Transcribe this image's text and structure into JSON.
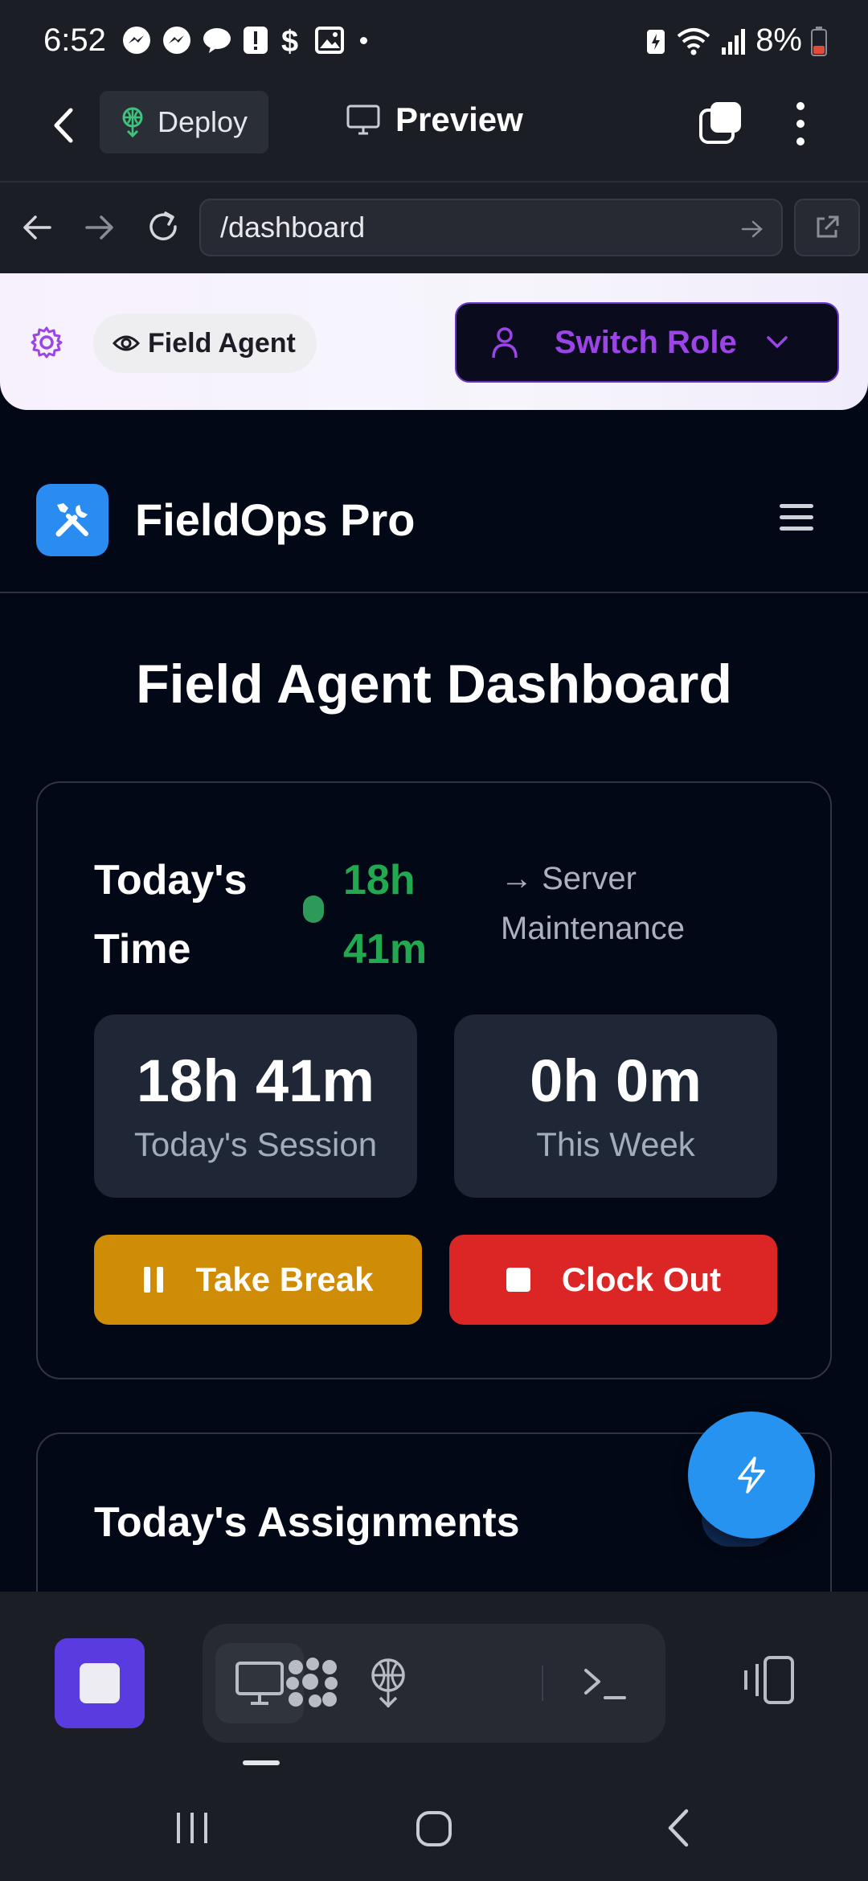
{
  "status_bar": {
    "time": "6:52",
    "battery": "8%"
  },
  "app_header": {
    "deploy_label": "Deploy",
    "preview_label": "Preview"
  },
  "url_bar": {
    "url": "/dashboard"
  },
  "role_bar": {
    "current_role": "Field Agent",
    "switch_label": "Switch Role"
  },
  "brand": {
    "name": "FieldOps Pro"
  },
  "page": {
    "title": "Field Agent Dashboard"
  },
  "time_card": {
    "label": "Today's Time",
    "elapsed": "18h 41m",
    "current_task": "→ Server Maintenance",
    "stats": [
      {
        "value": "18h 41m",
        "label": "Today's Session"
      },
      {
        "value": "0h 0m",
        "label": "This Week"
      }
    ],
    "break_label": "Take Break",
    "clock_out_label": "Clock Out"
  },
  "assignments": {
    "title": "Today's Assignments"
  },
  "colors": {
    "accent_purple": "#9b45e6",
    "brand_blue": "#2a8cf0",
    "success_green": "#22a94f",
    "break_amber": "#cf8c07",
    "danger_red": "#dc2626"
  }
}
